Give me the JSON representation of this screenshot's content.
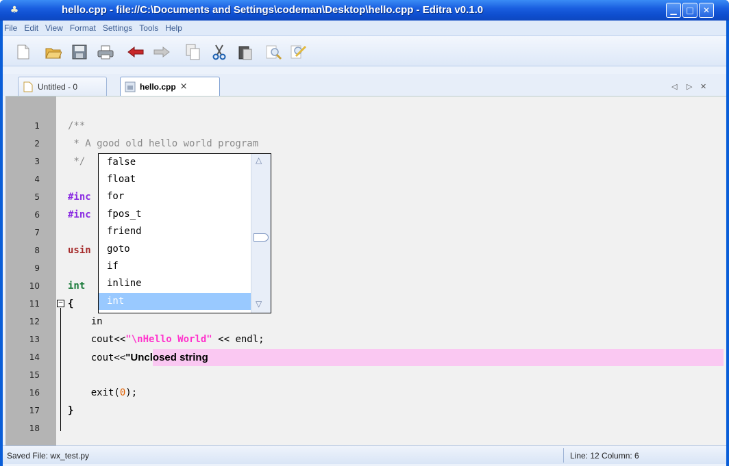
{
  "window": {
    "title": "hello.cpp - file://C:\\Documents and Settings\\codeman\\Desktop\\hello.cpp - Editra v0.1.0"
  },
  "menu": [
    "File",
    "Edit",
    "View",
    "Format",
    "Settings",
    "Tools",
    "Help"
  ],
  "toolbar": [
    "new-file-icon",
    "open-folder-icon",
    "save-icon",
    "print-icon",
    "back-arrow-icon",
    "forward-arrow-icon",
    "copy-icon",
    "cut-icon",
    "paste-icon",
    "find-icon",
    "replace-icon"
  ],
  "tabs": [
    {
      "label": "Untitled - 0",
      "icon": "document-icon",
      "active": false
    },
    {
      "label": "hello.cpp",
      "icon": "cpp-file-icon",
      "active": true,
      "close": "×"
    }
  ],
  "tab_nav": {
    "left": "◁",
    "right": "▷",
    "close": "✕"
  },
  "editor": {
    "lines": [
      {
        "n": "1",
        "text": "/**"
      },
      {
        "n": "2",
        "text": " * A good old hello world program"
      },
      {
        "n": "3",
        "text": " */"
      },
      {
        "n": "4",
        "text": ""
      },
      {
        "n": "5",
        "text": "#inc"
      },
      {
        "n": "6",
        "text": "#inc"
      },
      {
        "n": "7",
        "text": ""
      },
      {
        "n": "8",
        "text": "usin"
      },
      {
        "n": "9",
        "text": ""
      },
      {
        "n": "10",
        "text": "int"
      },
      {
        "n": "11",
        "text": "{"
      },
      {
        "n": "12",
        "text": "    in"
      },
      {
        "n": "13",
        "pre": "    cout<<",
        "str": "\"\\nHello World\"",
        "post": " << endl;"
      },
      {
        "n": "14",
        "pre": "    cout<<",
        "unclosed": "\"Unclosed string"
      },
      {
        "n": "15",
        "text": ""
      },
      {
        "n": "16",
        "pre": "    exit(",
        "num": "0",
        "post": ");"
      },
      {
        "n": "17",
        "text": "}"
      },
      {
        "n": "18",
        "text": ""
      }
    ],
    "fold_marker": "⊟"
  },
  "autocomplete": {
    "items": [
      "false",
      "float",
      "for",
      "fpos_t",
      "friend",
      "goto",
      "if",
      "inline",
      "int"
    ],
    "selected": "int"
  },
  "status": {
    "left": "Saved File: wx_test.py",
    "right": "Line: 12  Column: 6"
  },
  "colors": {
    "titlebar": "#1a5fe0",
    "preprocessor": "#8a2be2",
    "keyword": "#a52a2a",
    "string": "#ff33cc",
    "unclosed_bg": "#fac8f2",
    "selection": "#99c9ff"
  }
}
